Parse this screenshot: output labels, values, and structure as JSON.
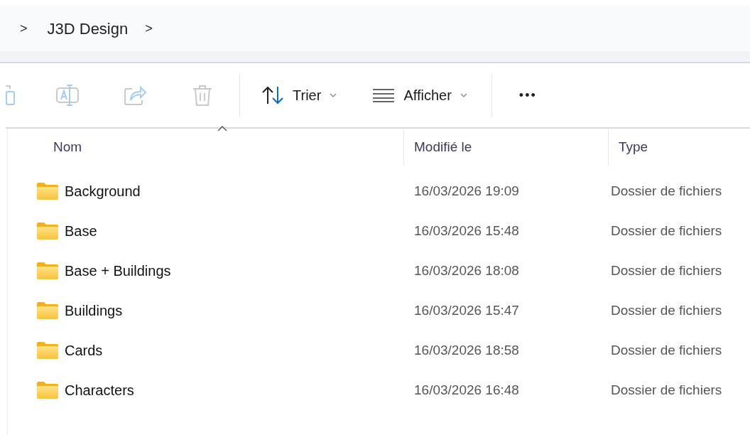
{
  "breadcrumb": {
    "separator_before": ">",
    "items": [
      {
        "label": "J3D Design",
        "separator_after": ">"
      }
    ]
  },
  "toolbar": {
    "actions": [
      {
        "kind": "paste",
        "disabled": true
      },
      {
        "kind": "rename",
        "disabled": true
      },
      {
        "kind": "share",
        "disabled": true
      },
      {
        "kind": "delete",
        "disabled": true
      }
    ],
    "menus": [
      {
        "kind": "sort",
        "label": "Trier"
      },
      {
        "kind": "view",
        "label": "Afficher"
      }
    ],
    "more": "•••"
  },
  "table": {
    "columns": [
      {
        "label": "Nom",
        "sorted": true
      },
      {
        "label": "Modifié le",
        "sorted": false
      },
      {
        "label": "Type",
        "sorted": false
      }
    ],
    "rows": [
      {
        "kind": "folder",
        "cells": [
          "Background",
          "16/03/2026 19:09",
          "Dossier de fichiers"
        ]
      },
      {
        "kind": "folder",
        "cells": [
          "Base",
          "16/03/2026 15:48",
          "Dossier de fichiers"
        ]
      },
      {
        "kind": "folder",
        "cells": [
          "Base + Buildings",
          "16/03/2026 18:08",
          "Dossier de fichiers"
        ]
      },
      {
        "kind": "folder",
        "cells": [
          "Buildings",
          "16/03/2026 15:47",
          "Dossier de fichiers"
        ]
      },
      {
        "kind": "folder",
        "cells": [
          "Cards",
          "16/03/2026 18:58",
          "Dossier de fichiers"
        ]
      },
      {
        "kind": "folder",
        "cells": [
          "Characters",
          "16/03/2026 16:48",
          "Dossier de fichiers"
        ]
      }
    ]
  }
}
